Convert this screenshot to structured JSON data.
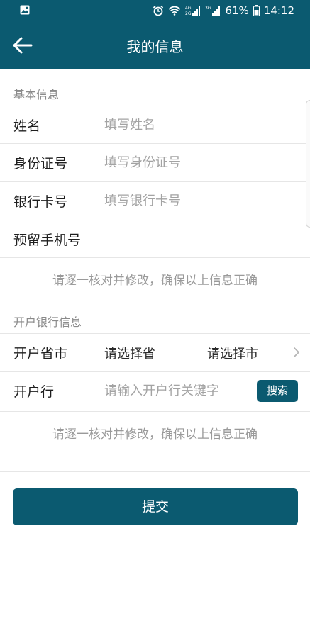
{
  "status_bar": {
    "battery": "61%",
    "time": "14:12",
    "icons": [
      "image-icon",
      "alarm-icon",
      "wifi-icon",
      "signal-4g-icon",
      "signal-3g-icon",
      "battery-icon"
    ]
  },
  "header": {
    "title": "我的信息",
    "back_icon": "back-arrow-icon"
  },
  "basic_section": {
    "title": "基本信息",
    "fields": [
      {
        "label": "姓名",
        "placeholder": "填写姓名",
        "value": ""
      },
      {
        "label": "身份证号",
        "placeholder": "填写身份证号",
        "value": ""
      },
      {
        "label": "银行卡号",
        "placeholder": "填写银行卡号",
        "value": ""
      },
      {
        "label": "预留手机号",
        "placeholder": "",
        "value": ""
      }
    ],
    "notice": "请逐一核对并修改，确保以上信息正确"
  },
  "bank_section": {
    "title": "开户银行信息",
    "province_city": {
      "label": "开户省市",
      "province": "请选择省",
      "city": "请选择市"
    },
    "branch": {
      "label": "开户行",
      "placeholder": "请输入开户行关键字",
      "value": "",
      "search_label": "搜索"
    },
    "notice": "请逐一核对并修改，确保以上信息正确"
  },
  "submit_label": "提交",
  "colors": {
    "primary": "#0b5a70",
    "hint": "#a3a3a3",
    "divider": "#e6e6e6"
  }
}
